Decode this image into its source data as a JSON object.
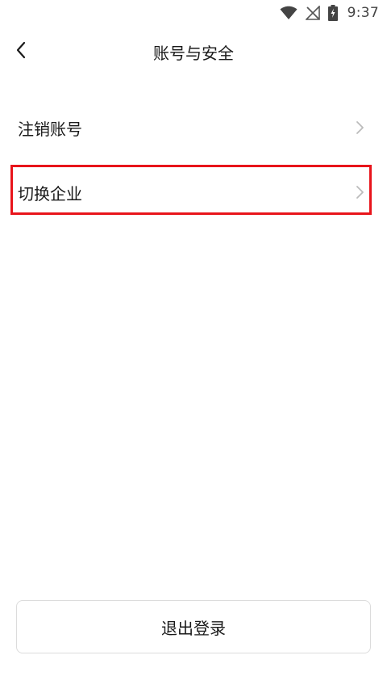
{
  "status_bar": {
    "time": "9:37",
    "icons": [
      "wifi-icon",
      "no-signal-icon",
      "battery-charging-icon"
    ]
  },
  "nav": {
    "title": "账号与安全",
    "back_icon": "chevron-left-icon"
  },
  "list": {
    "items": [
      {
        "label": "注销账号",
        "icon": "chevron-right-icon"
      },
      {
        "label": "切换企业",
        "icon": "chevron-right-icon",
        "highlighted": true
      }
    ]
  },
  "actions": {
    "logout_label": "退出登录"
  },
  "colors": {
    "highlight": "#e8141b",
    "chevron": "#bbbbbb",
    "text": "#1a1a1a"
  }
}
